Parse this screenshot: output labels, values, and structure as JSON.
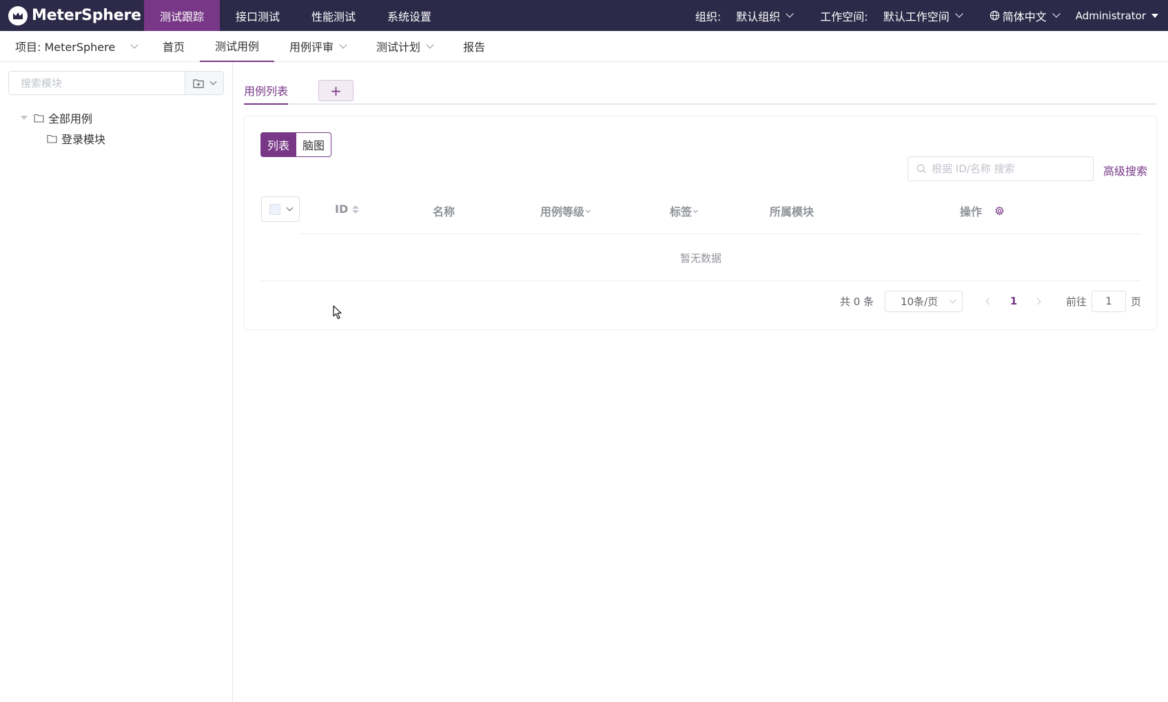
{
  "header": {
    "logo_text": "MeterSphere",
    "nav": [
      "测试跟踪",
      "接口测试",
      "性能测试",
      "系统设置"
    ],
    "org_label": "组织:",
    "org_value": "默认组织",
    "workspace_label": "工作空间:",
    "workspace_value": "默认工作空间",
    "language": "简体中文",
    "user": "Administrator"
  },
  "subnav": {
    "project": "项目: MeterSphere",
    "items": [
      "首页",
      "测试用例",
      "用例评审",
      "测试计划",
      "报告"
    ]
  },
  "aside": {
    "search_placeholder": "搜索模块",
    "tree_root": "全部用例",
    "tree_child": "登录模块"
  },
  "main": {
    "tab_label": "用例列表",
    "tab_add": "+",
    "view_list": "列表",
    "view_mind": "脑图",
    "search_placeholder": "根据 ID/名称 搜索",
    "advanced_search": "高级搜索",
    "columns": [
      "ID",
      "名称",
      "用例等级",
      "标签",
      "所属模块",
      "操作"
    ],
    "empty_text": "暂无数据",
    "pager": {
      "total": "共 0 条",
      "page_size": "10条/页",
      "current": "1",
      "goto_label": "前往",
      "goto_value": "1",
      "page_suffix": "页"
    }
  },
  "colors": {
    "accent": "#783887",
    "header_bg": "#2c2a48"
  }
}
